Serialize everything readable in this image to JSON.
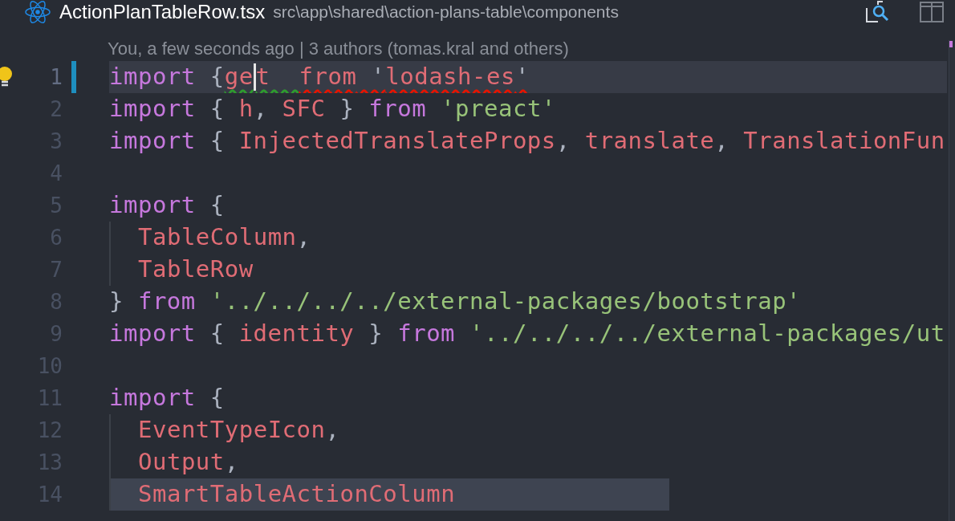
{
  "tab": {
    "filename": "ActionPlanTableRow.tsx",
    "path": "src\\app\\shared\\action-plans-table\\components"
  },
  "blame": "You, a few seconds ago | 3 authors (tomas.kral and others)",
  "lines": [
    {
      "number": "1",
      "current": true,
      "modified": true,
      "lightbulb": true,
      "guide": false,
      "selected": false,
      "tokens": [
        {
          "kind": "keyword",
          "text": "import"
        },
        {
          "kind": "punct",
          "text": " {"
        },
        {
          "kind": "ident",
          "text": "ge",
          "warning": true
        },
        {
          "kind": "ident",
          "text": "t  ",
          "warning": true,
          "caret": true
        },
        {
          "kind": "ident",
          "text": "from",
          "error": true
        },
        {
          "kind": "punct",
          "text": " '",
          "error": true
        },
        {
          "kind": "ident",
          "text": "lodash-es",
          "error": true
        },
        {
          "kind": "punct",
          "text": "'",
          "error": true
        }
      ]
    },
    {
      "number": "2",
      "current": false,
      "modified": false,
      "lightbulb": false,
      "guide": false,
      "selected": false,
      "tokens": [
        {
          "kind": "keyword",
          "text": "import"
        },
        {
          "kind": "punct",
          "text": " { "
        },
        {
          "kind": "ident",
          "text": "h"
        },
        {
          "kind": "punct",
          "text": ", "
        },
        {
          "kind": "ident",
          "text": "SFC"
        },
        {
          "kind": "punct",
          "text": " } "
        },
        {
          "kind": "keyword",
          "text": "from"
        },
        {
          "kind": "string",
          "text": " 'preact'"
        }
      ]
    },
    {
      "number": "3",
      "current": false,
      "modified": false,
      "lightbulb": false,
      "guide": false,
      "selected": false,
      "tokens": [
        {
          "kind": "keyword",
          "text": "import"
        },
        {
          "kind": "punct",
          "text": " { "
        },
        {
          "kind": "ident",
          "text": "InjectedTranslateProps"
        },
        {
          "kind": "punct",
          "text": ", "
        },
        {
          "kind": "ident",
          "text": "translate"
        },
        {
          "kind": "punct",
          "text": ", "
        },
        {
          "kind": "ident",
          "text": "TranslationFun"
        }
      ]
    },
    {
      "number": "4",
      "current": false,
      "modified": false,
      "lightbulb": false,
      "guide": false,
      "selected": false
    },
    {
      "number": "5",
      "current": false,
      "modified": false,
      "lightbulb": false,
      "guide": false,
      "selected": false,
      "tokens": [
        {
          "kind": "keyword",
          "text": "import"
        },
        {
          "kind": "punct",
          "text": " {"
        }
      ]
    },
    {
      "number": "6",
      "current": false,
      "modified": false,
      "lightbulb": false,
      "guide": true,
      "selected": false,
      "tokens": [
        {
          "kind": "ident",
          "text": "TableColumn"
        },
        {
          "kind": "punct",
          "text": ","
        }
      ]
    },
    {
      "number": "7",
      "current": false,
      "modified": false,
      "lightbulb": false,
      "guide": true,
      "selected": false,
      "tokens": [
        {
          "kind": "ident",
          "text": "TableRow"
        }
      ]
    },
    {
      "number": "8",
      "current": false,
      "modified": false,
      "lightbulb": false,
      "guide": false,
      "selected": false,
      "tokens": [
        {
          "kind": "punct",
          "text": "} "
        },
        {
          "kind": "keyword",
          "text": "from"
        },
        {
          "kind": "string",
          "text": " '../../../../external-packages/bootstrap'"
        }
      ]
    },
    {
      "number": "9",
      "current": false,
      "modified": false,
      "lightbulb": false,
      "guide": false,
      "selected": false,
      "tokens": [
        {
          "kind": "keyword",
          "text": "import"
        },
        {
          "kind": "punct",
          "text": " { "
        },
        {
          "kind": "ident",
          "text": "identity"
        },
        {
          "kind": "punct",
          "text": " } "
        },
        {
          "kind": "keyword",
          "text": "from"
        },
        {
          "kind": "string",
          "text": " '../../../../external-packages/ut"
        }
      ]
    },
    {
      "number": "10",
      "current": false,
      "modified": false,
      "lightbulb": false,
      "guide": false,
      "selected": false
    },
    {
      "number": "11",
      "current": false,
      "modified": false,
      "lightbulb": false,
      "guide": false,
      "selected": false,
      "tokens": [
        {
          "kind": "keyword",
          "text": "import"
        },
        {
          "kind": "punct",
          "text": " {"
        }
      ]
    },
    {
      "number": "12",
      "current": false,
      "modified": false,
      "lightbulb": false,
      "guide": true,
      "selected": false,
      "tokens": [
        {
          "kind": "ident",
          "text": "EventTypeIcon"
        },
        {
          "kind": "punct",
          "text": ","
        }
      ]
    },
    {
      "number": "13",
      "current": false,
      "modified": false,
      "lightbulb": false,
      "guide": true,
      "selected": false,
      "tokens": [
        {
          "kind": "ident",
          "text": "Output"
        },
        {
          "kind": "punct",
          "text": ","
        }
      ]
    },
    {
      "number": "14",
      "current": false,
      "modified": false,
      "lightbulb": false,
      "guide": true,
      "selected": true,
      "tokens": [
        {
          "kind": "ident",
          "text": "SmartTableActionColumn"
        }
      ]
    }
  ]
}
